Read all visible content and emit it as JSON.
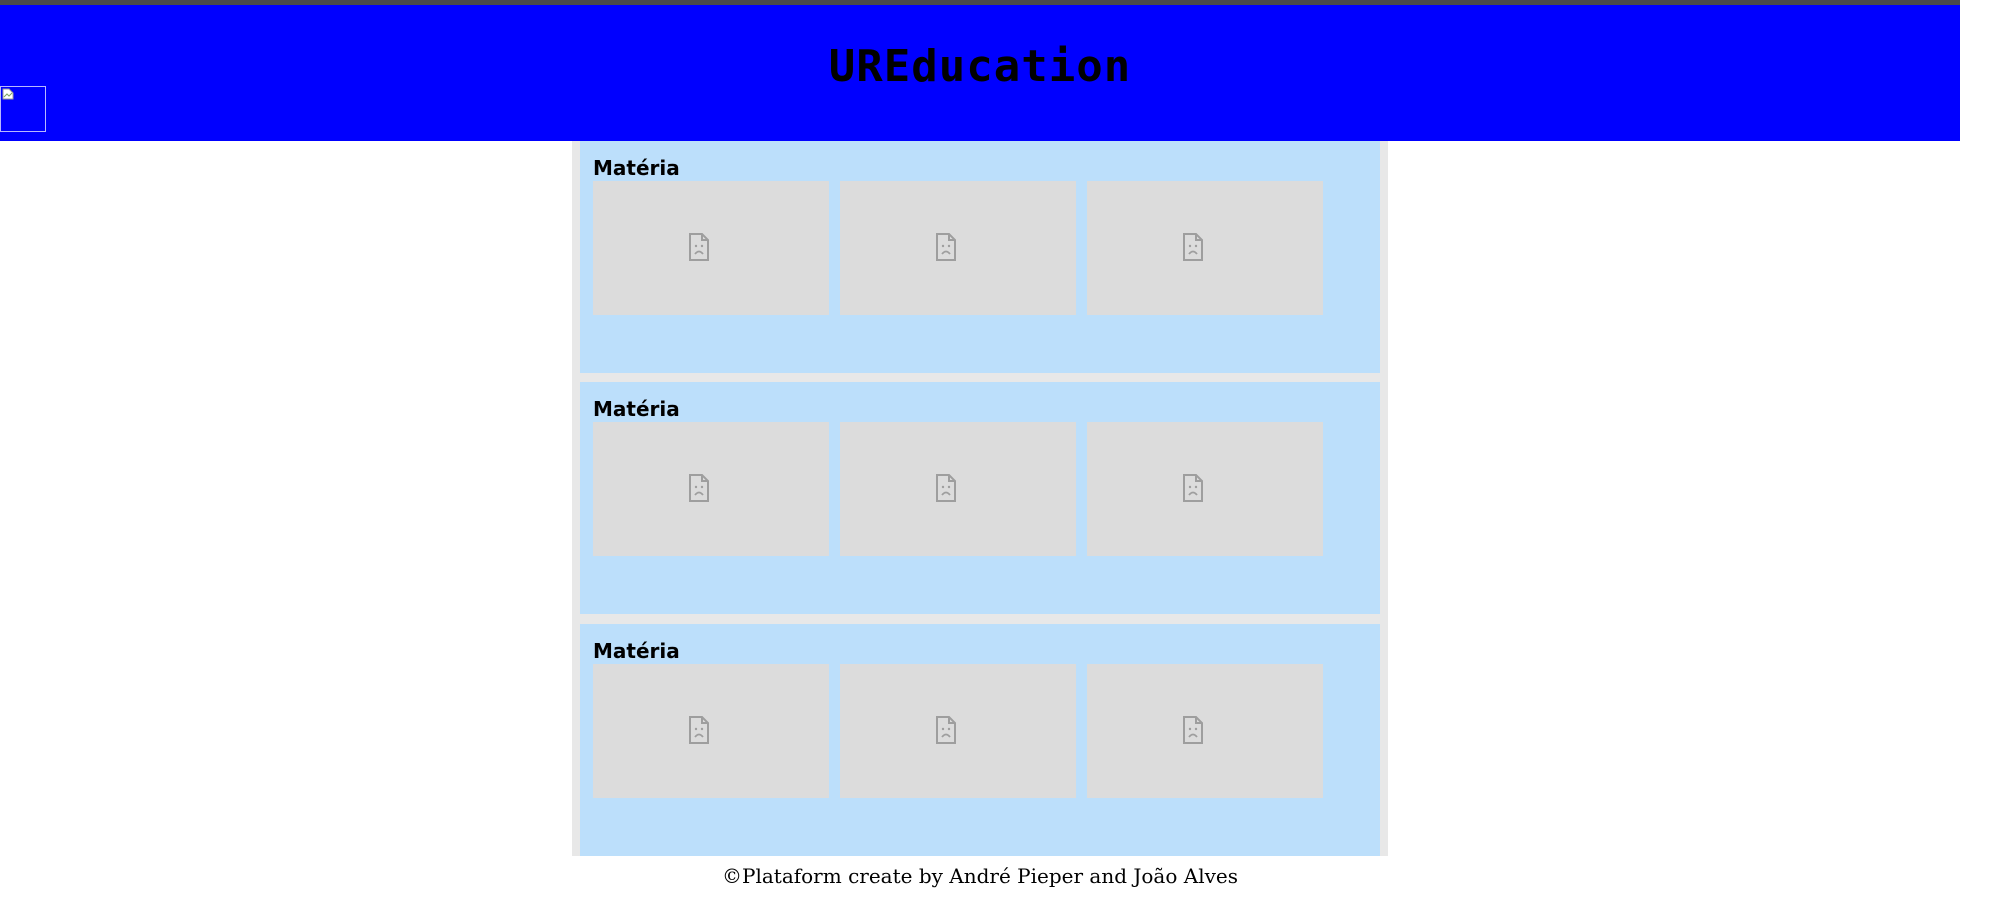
{
  "header": {
    "title": "UREducation",
    "logo_icon": "broken-image-icon",
    "background_color": "#0000ff"
  },
  "subjects": [
    {
      "title": "Matéria",
      "thumbnails": [
        "image-placeholder-icon",
        "image-placeholder-icon",
        "image-placeholder-icon"
      ]
    },
    {
      "title": "Matéria",
      "thumbnails": [
        "image-placeholder-icon",
        "image-placeholder-icon",
        "image-placeholder-icon"
      ]
    },
    {
      "title": "Matéria",
      "thumbnails": [
        "image-placeholder-icon",
        "image-placeholder-icon",
        "image-placeholder-icon"
      ]
    }
  ],
  "colors": {
    "card": "#bcdffb",
    "panel": "#e8e8e8",
    "thumbnail": "#dcdcdc"
  },
  "footer": {
    "text": "©Plataform create by André Pieper and João Alves"
  }
}
